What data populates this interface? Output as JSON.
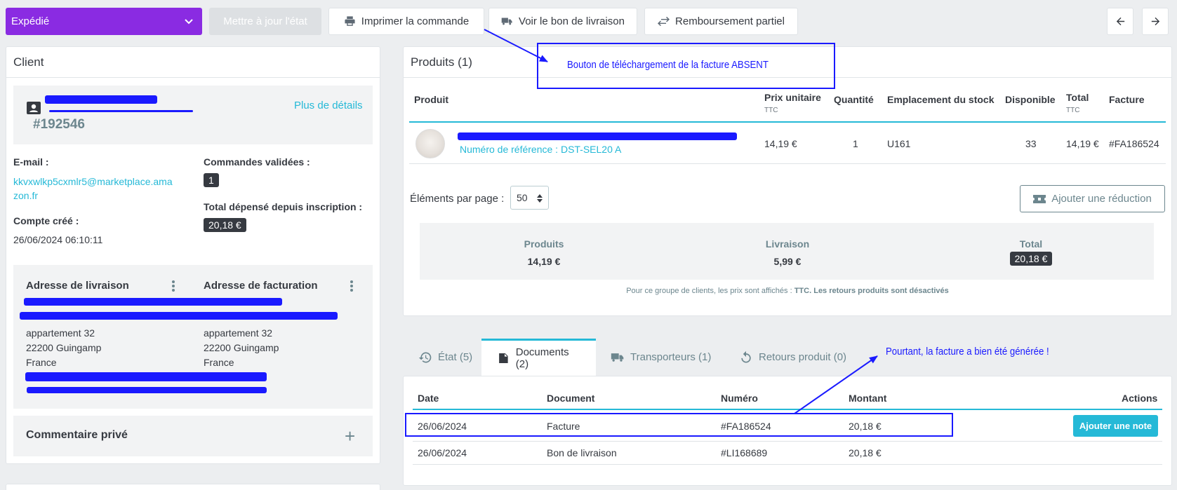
{
  "toolbar": {
    "status_select": "Expédié",
    "update_status": "Mettre à jour l'état",
    "print_order": "Imprimer la commande",
    "view_delivery_slip": "Voir le bon de livraison",
    "partial_refund": "Remboursement partiel"
  },
  "client": {
    "title": "Client",
    "id": "#192546",
    "more_details": "Plus de détails",
    "email_label": "E-mail :",
    "email_line1": "kkvxwlkp5cxmlr5@marketplace.ama",
    "email_line2": "zon.fr",
    "validated_orders_label": "Commandes validées :",
    "validated_orders_count": "1",
    "account_created_label": "Compte créé :",
    "account_created_value": "26/06/2024 06:10:11",
    "total_spent_label": "Total dépensé depuis inscription :",
    "total_spent_value": "20,18 €",
    "shipping_address_title": "Adresse de livraison",
    "billing_address_title": "Adresse de facturation",
    "shipping_address": [
      "appartement 32",
      "22200 Guingamp",
      "France"
    ],
    "billing_address": [
      "appartement 32",
      "22200 Guingamp",
      "France"
    ],
    "private_comment_title": "Commentaire privé",
    "add_symbol": "+"
  },
  "products": {
    "title": "Produits (1)",
    "columns": {
      "product": "Produit",
      "unit_price": "Prix unitaire",
      "unit_price_sub": "TTC",
      "quantity": "Quantité",
      "stock_location": "Emplacement du stock",
      "available": "Disponible",
      "total": "Total",
      "total_sub": "TTC",
      "invoice": "Facture"
    },
    "row": {
      "reference": "Numéro de référence : DST-SEL20 A",
      "unit_price": "14,19 €",
      "quantity": "1",
      "location": "U161",
      "available": "33",
      "total": "14,19 €",
      "invoice": "#FA186524"
    },
    "per_page_label": "Éléments par page :",
    "per_page_value": "50",
    "add_discount": "Ajouter une réduction",
    "summary": {
      "products_label": "Produits",
      "products_value": "14,19 €",
      "shipping_label": "Livraison",
      "shipping_value": "5,99 €",
      "total_label": "Total",
      "total_value": "20,18 €"
    },
    "footnote_prefix": "Pour ce groupe de clients, les prix sont affichés : ",
    "footnote_ttc": "TTC",
    "footnote_returns": "Les retours produits sont désactivés"
  },
  "tabs": {
    "status": "État (5)",
    "documents": "Documents (2)",
    "carriers": "Transporteurs (1)",
    "returns": "Retours produit (0)"
  },
  "documents": {
    "columns": {
      "date": "Date",
      "document": "Document",
      "number": "Numéro",
      "amount": "Montant",
      "actions": "Actions"
    },
    "rows": [
      {
        "date": "26/06/2024",
        "document": "Facture",
        "number": "#FA186524",
        "amount": "20,18 €",
        "action": "Ajouter une note"
      },
      {
        "date": "26/06/2024",
        "document": "Bon de livraison",
        "number": "#LI168689",
        "amount": "20,18 €"
      }
    ]
  },
  "annotations": {
    "missing_button": "Bouton de téléchargement de la facture ABSENT",
    "invoice_generated": "Pourtant, la facture a bien été générée !"
  },
  "colors": {
    "status_purple": "#8a2be2",
    "accent": "#25b9d7",
    "annotation_blue": "#1a1aff"
  }
}
